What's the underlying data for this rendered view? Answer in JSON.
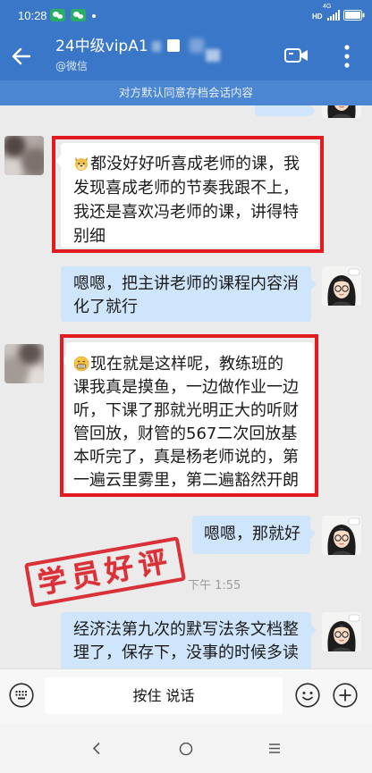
{
  "status_bar": {
    "time": "10:28",
    "hd_label": "HD",
    "network_label": "4G",
    "notification_icons": [
      "wechat-icon",
      "wechat-icon"
    ]
  },
  "header": {
    "title": "24中级vipA1",
    "subtitle": "@微信",
    "back_icon": "back-arrow-icon",
    "video_icon": "video-call-icon",
    "more_icon": "more-vertical-icon"
  },
  "banner": {
    "text": "对方默认同意存档会话内容"
  },
  "messages": [
    {
      "outgoing": false,
      "highlighted": true,
      "leading_emoji": "dog-face-emoji-icon",
      "lines": [
        "都没好好听喜成老师的课，我",
        "发现喜成老师的节奏我跟不上，",
        "我还是喜欢冯老师的课，讲得特",
        "别细"
      ]
    },
    {
      "outgoing": true,
      "highlighted": false,
      "lines": [
        "嗯嗯，把主讲老师的课程内容消",
        "化了就行"
      ]
    },
    {
      "outgoing": false,
      "highlighted": true,
      "leading_emoji": "grinning-face-emoji-icon",
      "lines": [
        "现在就是这样呢，教练班的",
        "课我真是摸鱼，一边做作业一边",
        "听，下课了那就光明正大的听财",
        "管回放，财管的567二次回放基",
        "本听完了，真是杨老师说的，第",
        "一遍云里雾里，第二遍豁然开朗"
      ]
    },
    {
      "outgoing": true,
      "highlighted": false,
      "lines": [
        "嗯嗯，那就好"
      ]
    },
    {
      "outgoing": true,
      "highlighted": false,
      "lines": [
        "经济法第九次的默写法条文档整",
        "理了，保存下，没事的时候多读"
      ]
    }
  ],
  "timestamp": "下午 1:55",
  "stamp": {
    "text": "学员好评"
  },
  "input_bar": {
    "voice_button_label": "按住 说话",
    "keyboard_icon": "keyboard-icon",
    "emoji_icon": "emoji-icon",
    "plus_icon": "plus-icon"
  },
  "nav_bar": {
    "icons": [
      "nav-back-icon",
      "nav-home-icon",
      "nav-menu-icon"
    ]
  },
  "colors": {
    "header_blue": "#3a77c8",
    "banner_blue": "#4b86d2",
    "chat_background": "#ebebeb",
    "right_bubble": "#cfe5fb",
    "highlight_red": "#e11b1f",
    "stamp_red": "#d8232a"
  }
}
